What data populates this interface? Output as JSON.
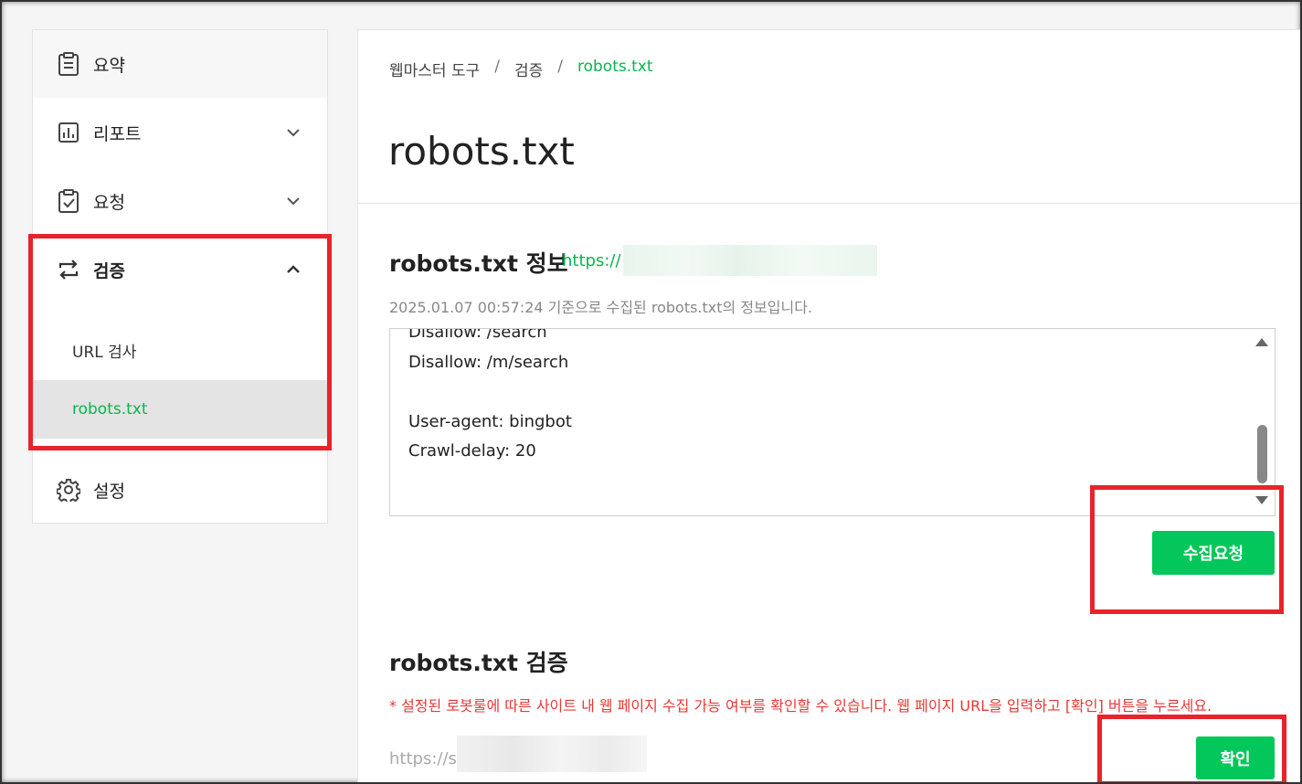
{
  "sidebar": {
    "items": [
      {
        "label": "요약",
        "icon": "clipboard-icon"
      },
      {
        "label": "리포트",
        "icon": "bar-chart-icon"
      },
      {
        "label": "요청",
        "icon": "checklist-icon"
      },
      {
        "label": "검증",
        "icon": "repeat-icon"
      },
      {
        "label": "설정",
        "icon": "gear-icon"
      }
    ],
    "verify_sub": [
      {
        "label": "URL 검사"
      },
      {
        "label": "robots.txt"
      }
    ]
  },
  "breadcrumb": {
    "items": [
      "웹마스터 도구",
      "검증",
      "robots.txt"
    ],
    "separator": "/"
  },
  "page": {
    "title": "robots.txt"
  },
  "info": {
    "title": "robots.txt 정보",
    "url_prefix": "https://",
    "description": "2025.01.07 00:57:24 기준으로 수집된 robots.txt의 정보입니다.",
    "content": "Disallow: /search\nDisallow: /m/search\n\nUser-agent: bingbot\nCrawl-delay: 20",
    "collect_button": "수집요청"
  },
  "verify": {
    "title": "robots.txt 검증",
    "note": "* 설정된 로봇룰에 따른 사이트 내 웹 페이지 수집 가능 여부를 확인할 수 있습니다. 웹 페이지 URL을 입력하고 [확인] 버튼을 누르세요.",
    "input_value": "https://s",
    "confirm_button": "확인"
  },
  "colors": {
    "accent": "#03c75a",
    "active_text": "#0bb34f",
    "warning": "#e53935",
    "annotation": "#e8232b"
  }
}
